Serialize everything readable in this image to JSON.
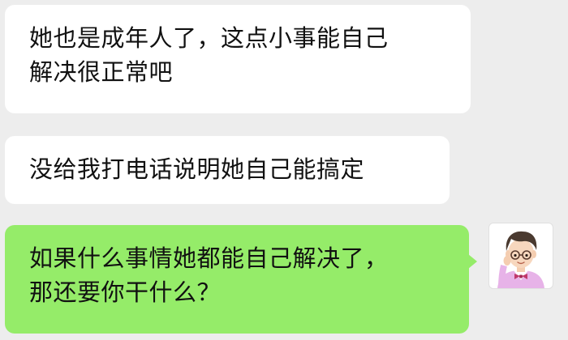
{
  "messages": [
    {
      "direction": "incoming",
      "lines": [
        "她也是成年人了，这点小事能自己",
        "解决很正常吧"
      ]
    },
    {
      "direction": "incoming",
      "lines": [
        "没给我打电话说明她自己能搞定"
      ]
    },
    {
      "direction": "outgoing",
      "lines": [
        "如果什么事情她都能自己解决了，",
        "那还要你干什么？"
      ]
    }
  ],
  "sender_avatar": {
    "icon": "cartoon-man-glasses-bowtie-avatar-icon"
  },
  "colors": {
    "background": "#ededed",
    "incoming_bubble": "#ffffff",
    "outgoing_bubble": "#95ec69",
    "text": "#111111"
  }
}
